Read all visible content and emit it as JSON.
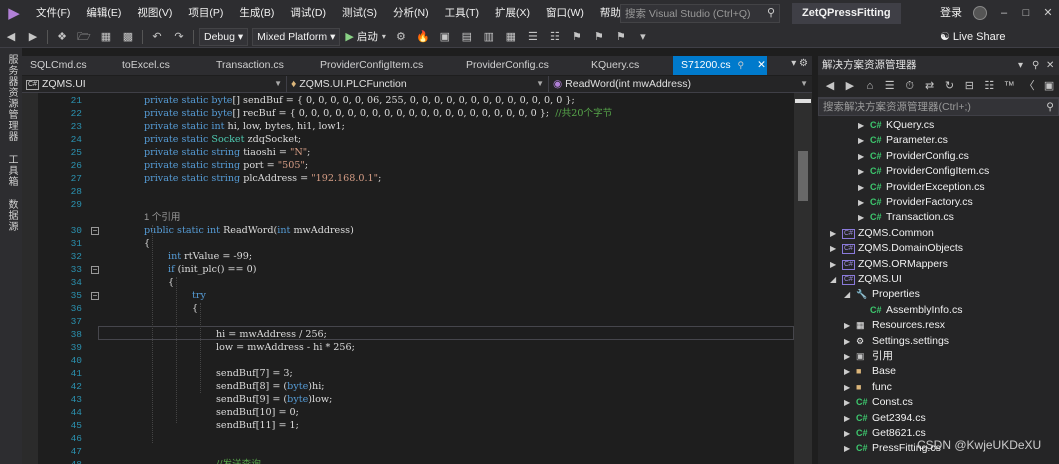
{
  "menu": {
    "items": [
      "文件(F)",
      "编辑(E)",
      "视图(V)",
      "项目(P)",
      "生成(B)",
      "调试(D)",
      "测试(S)",
      "分析(N)",
      "工具(T)",
      "扩展(X)",
      "窗口(W)",
      "帮助(H)"
    ],
    "search_placeholder": "搜索 Visual Studio (Ctrl+Q)",
    "solution_name": "ZetQPressFitting",
    "login": "登录"
  },
  "toolbar": {
    "config": "Debug",
    "platform": "Mixed Platform",
    "start": "启动",
    "live_share": "Live Share"
  },
  "left_strip": [
    "服务器资源管理器",
    "工具箱",
    "数据源"
  ],
  "editor_tabs": [
    {
      "label": "SQLCmd.cs"
    },
    {
      "label": "toExcel.cs"
    },
    {
      "label": "Transaction.cs"
    },
    {
      "label": "ProviderConfigItem.cs"
    },
    {
      "label": "ProviderConfig.cs"
    },
    {
      "label": "KQuery.cs"
    },
    {
      "label": "S71200.cs",
      "active": true
    }
  ],
  "navbar": {
    "project": "ZQMS.UI",
    "class": "ZQMS.UI.PLCFunction",
    "member": "ReadWord(int mwAddress)"
  },
  "code_lines": [
    {
      "no": "21",
      "text": "private static byte[] sendBuf = { 0, 0, 0, 0, 0, 06, 255, 0, 0, 0, 0, 0, 0, 0, 0, 0, 0, 0, 0, 0 };"
    },
    {
      "no": "22",
      "text": "private static byte[] recBuf = { 0, 0, 0, 0, 0, 0, 0, 0, 0, 0, 0, 0, 0, 0, 0, 0, 0, 0, 0, 0 };  //共20个字节"
    },
    {
      "no": "23",
      "text": "private static int hi, low, bytes, hi1, low1;"
    },
    {
      "no": "24",
      "text": "private static Socket zdqSocket;"
    },
    {
      "no": "25",
      "text": "private static string tiaoshi = \"N\";"
    },
    {
      "no": "26",
      "text": "private static string port = \"505\";"
    },
    {
      "no": "27",
      "text": "private static string plcAddress = \"192.168.0.1\";"
    },
    {
      "no": "28",
      "text": ""
    },
    {
      "no": "29",
      "text": ""
    },
    {
      "no": "",
      "text": "1 个引用"
    },
    {
      "no": "30",
      "text": "public static int ReadWord(int mwAddress)"
    },
    {
      "no": "31",
      "text": "{"
    },
    {
      "no": "32",
      "text": "int rtValue = -99;"
    },
    {
      "no": "33",
      "text": "if (init_plc() == 0)"
    },
    {
      "no": "34",
      "text": "{"
    },
    {
      "no": "35",
      "text": "try"
    },
    {
      "no": "36",
      "text": "{"
    },
    {
      "no": "37",
      "text": ""
    },
    {
      "no": "38",
      "text": "hi = mwAddress / 256;"
    },
    {
      "no": "39",
      "text": "low = mwAddress - hi * 256;"
    },
    {
      "no": "40",
      "text": ""
    },
    {
      "no": "41",
      "text": "sendBuf[7] = 3;"
    },
    {
      "no": "42",
      "text": "sendBuf[8] = (byte)hi;"
    },
    {
      "no": "43",
      "text": "sendBuf[9] = (byte)low;"
    },
    {
      "no": "44",
      "text": "sendBuf[10] = 0;"
    },
    {
      "no": "45",
      "text": "sendBuf[11] = 1;"
    },
    {
      "no": "46",
      "text": ""
    },
    {
      "no": "47",
      "text": ""
    },
    {
      "no": "48",
      "text": "//发送查询"
    }
  ],
  "solution_explorer": {
    "title": "解决方案资源管理器",
    "search_placeholder": "搜索解决方案资源管理器(Ctrl+;)",
    "items": [
      {
        "label": "KQuery.cs",
        "icon": "cs"
      },
      {
        "label": "Parameter.cs",
        "icon": "cs"
      },
      {
        "label": "ProviderConfig.cs",
        "icon": "cs"
      },
      {
        "label": "ProviderConfigItem.cs",
        "icon": "cs"
      },
      {
        "label": "ProviderException.cs",
        "icon": "cs"
      },
      {
        "label": "ProviderFactory.cs",
        "icon": "cs"
      },
      {
        "label": "Transaction.cs",
        "icon": "cs"
      },
      {
        "label": "ZQMS.Common",
        "icon": "proj"
      },
      {
        "label": "ZQMS.DomainObjects",
        "icon": "proj"
      },
      {
        "label": "ZQMS.ORMappers",
        "icon": "proj"
      },
      {
        "label": "ZQMS.UI",
        "icon": "proj"
      },
      {
        "label": "Properties",
        "icon": "props"
      },
      {
        "label": "AssemblyInfo.cs",
        "icon": "cs"
      },
      {
        "label": "Resources.resx",
        "icon": "resx"
      },
      {
        "label": "Settings.settings",
        "icon": "settings"
      },
      {
        "label": "引用",
        "icon": "ref"
      },
      {
        "label": "Base",
        "icon": "folder"
      },
      {
        "label": "func",
        "icon": "folder"
      },
      {
        "label": "Const.cs",
        "icon": "cs"
      },
      {
        "label": "Get2394.cs",
        "icon": "cs"
      },
      {
        "label": "Get8621.cs",
        "icon": "cs"
      },
      {
        "label": "PressFitting.cs",
        "icon": "cs"
      }
    ]
  },
  "watermark": "CSDN @KwjeUKDeXU",
  "colors": {
    "accent": "#007acc",
    "keyword": "#569cd6",
    "string": "#d69d85",
    "comment": "#57a64a",
    "line_number": "#2b91af"
  }
}
